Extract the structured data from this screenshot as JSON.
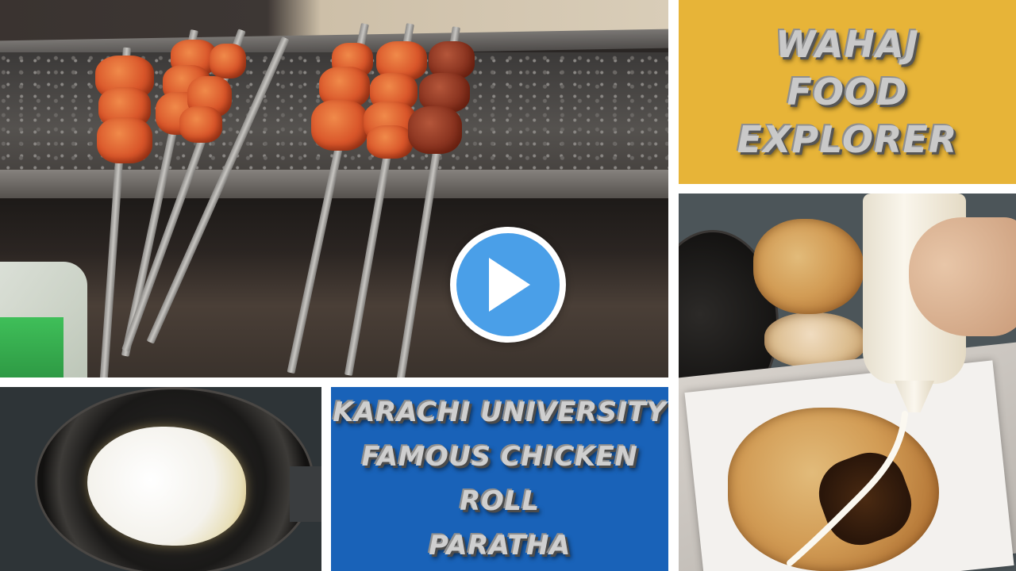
{
  "thumbnail": {
    "brand_card": {
      "line1": "WAHAJ",
      "line2": "FOOD",
      "line3": "EXPLORER",
      "background": "#e7b438"
    },
    "caption_card": {
      "line1": "KARACHI UNIVERSITY",
      "line2": "FAMOUS CHICKEN ROLL",
      "line3": "PARATHA",
      "background": "#1962b8"
    },
    "play_button": {
      "icon": "play-icon",
      "color": "#4a9fe8"
    }
  }
}
